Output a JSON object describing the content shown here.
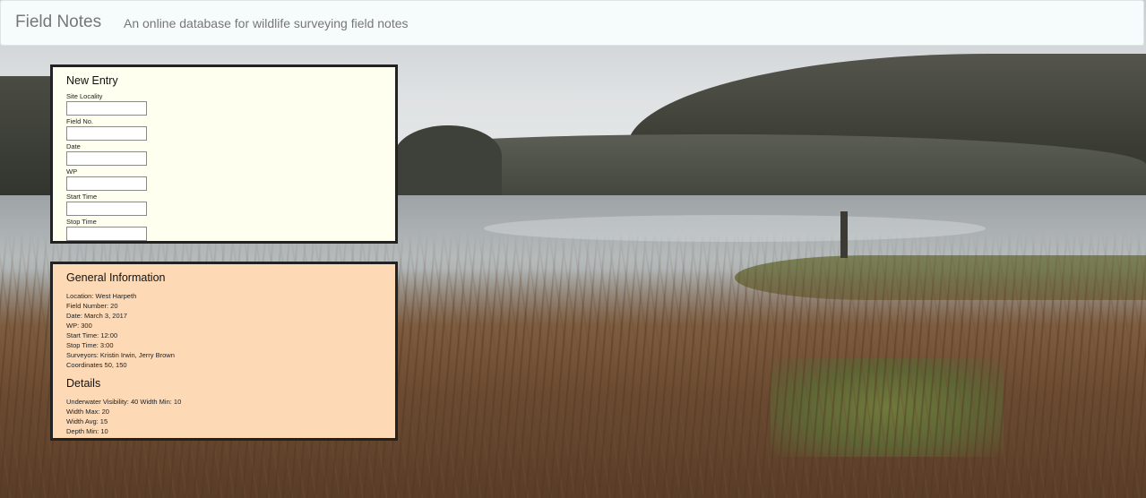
{
  "navbar": {
    "brand": "Field Notes",
    "tagline": "An online database for wildlife surveying field notes"
  },
  "new_entry": {
    "title": "New Entry",
    "fields": [
      {
        "label": "Site Locality",
        "value": ""
      },
      {
        "label": "Field No.",
        "value": ""
      },
      {
        "label": "Date",
        "value": ""
      },
      {
        "label": "WP",
        "value": ""
      },
      {
        "label": "Start Time",
        "value": ""
      },
      {
        "label": "Stop Time",
        "value": ""
      }
    ]
  },
  "general_info": {
    "title": "General Information",
    "lines": [
      "Location: West Harpeth",
      "Field Number: 20",
      "Date: March 3, 2017",
      "WP: 300",
      "Start Time: 12:00",
      "Stop Time: 3:00",
      "Surveyors: Kristin Irwin, Jerry Brown",
      "Coordinates 50, 150"
    ]
  },
  "details": {
    "title": "Details",
    "lines": [
      "Underwater Visibility: 40 Width Min: 10",
      "Width Max: 20",
      "Width Avg: 15",
      "Depth Min: 10"
    ]
  },
  "colors": {
    "navbar_bg": "#f5fcfb",
    "new_entry_bg": "#fffff0",
    "info_bg": "#fdd9b5",
    "panel_border": "#222222"
  }
}
